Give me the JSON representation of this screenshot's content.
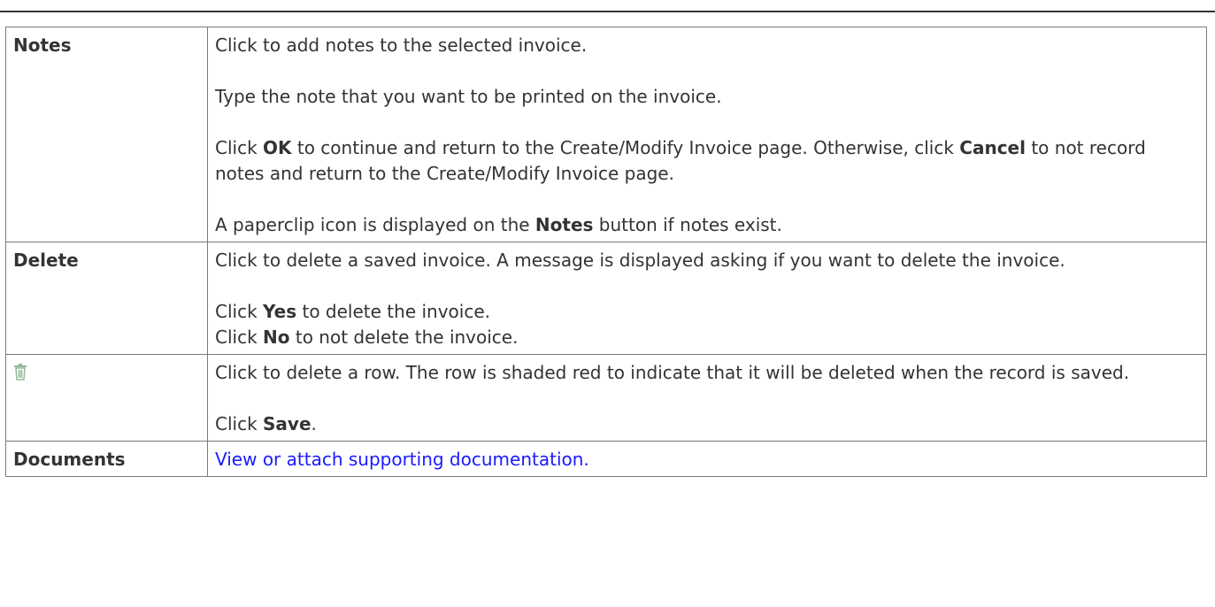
{
  "rows": [
    {
      "term": "Notes",
      "paragraphs": [
        {
          "segments": [
            {
              "t": "Click to add notes to the selected invoice."
            }
          ]
        },
        {
          "segments": [
            {
              "t": "Type the note that you want to be printed on the invoice."
            }
          ]
        },
        {
          "segments": [
            {
              "t": "Click "
            },
            {
              "t": "OK",
              "b": true
            },
            {
              "t": " to continue and return to the Create/Modify Invoice page. Otherwise, click "
            },
            {
              "t": "Cancel",
              "b": true
            },
            {
              "t": " to not record notes and return to the Create/Modify Invoice page."
            }
          ]
        },
        {
          "segments": [
            {
              "t": "A paperclip icon is displayed on the "
            },
            {
              "t": "Notes",
              "b": true
            },
            {
              "t": " button if notes exist."
            }
          ]
        }
      ]
    },
    {
      "term": "Delete",
      "paragraphs": [
        {
          "segments": [
            {
              "t": "Click to delete a saved invoice. A message is displayed asking if you want to delete the invoice."
            }
          ]
        },
        {
          "segments": [
            {
              "t": "Click "
            },
            {
              "t": "Yes",
              "b": true
            },
            {
              "t": " to delete the invoice."
            }
          ],
          "br_after": true
        },
        {
          "segments": [
            {
              "t": "Click "
            },
            {
              "t": "No",
              "b": true
            },
            {
              "t": " to not delete the invoice."
            }
          ],
          "no_gap": true
        }
      ]
    },
    {
      "icon": "trash-icon",
      "paragraphs": [
        {
          "segments": [
            {
              "t": "Click to delete a row. The row is shaded red to indicate that it will be deleted when the record is saved."
            }
          ]
        },
        {
          "segments": [
            {
              "t": "Click "
            },
            {
              "t": "Save",
              "b": true
            },
            {
              "t": "."
            }
          ]
        }
      ]
    },
    {
      "term": "Documents",
      "link": "View or attach supporting documentation."
    }
  ],
  "colors": {
    "text": "#333333",
    "border": "#7a7a7a",
    "link": "#1a1aff",
    "icon": "#8fb89a"
  }
}
